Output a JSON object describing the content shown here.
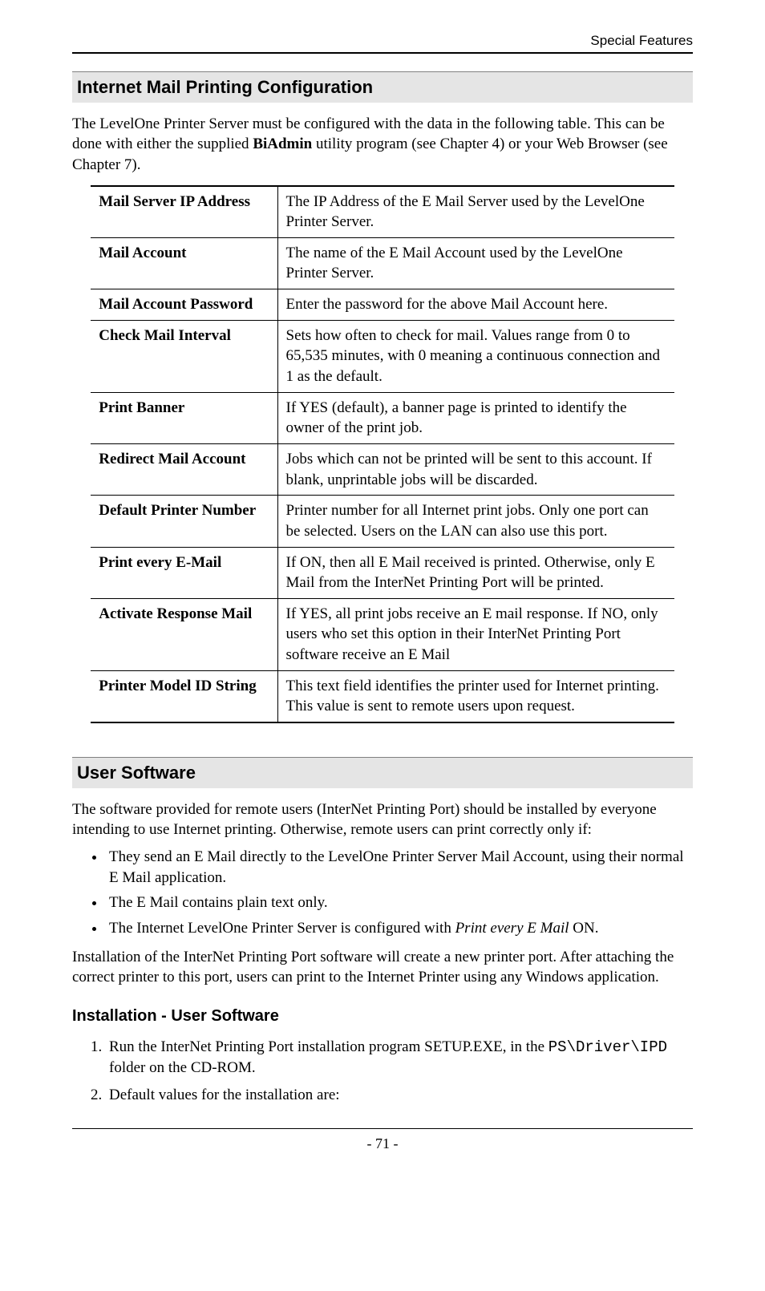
{
  "header": {
    "title": "Special Features"
  },
  "section1": {
    "heading": "Internet Mail Printing Configuration",
    "intro_pre": "The LevelOne Printer Server must be configured with the data in the following table. This can be done with either the supplied ",
    "intro_bold": "BiAdmin",
    "intro_post": " utility program (see Chapter 4) or your Web Browser (see Chapter 7)."
  },
  "table": {
    "rows": [
      {
        "label": "Mail Server IP Address",
        "desc": "The IP Address of the E Mail Server used by the LevelOne Printer Server."
      },
      {
        "label": "Mail Account",
        "desc": "The name of the E Mail Account used by the LevelOne Printer Server."
      },
      {
        "label": "Mail Account Password",
        "desc": "Enter the password for the above Mail Account here."
      },
      {
        "label": "Check Mail Interval",
        "desc": "Sets how often to check for mail. Values range from 0 to 65,535 minutes, with 0 meaning a continuous connection and 1 as the default."
      },
      {
        "label": "Print Banner",
        "desc": "If YES (default), a banner page is printed to identify the owner of the print job."
      },
      {
        "label": "Redirect Mail Account",
        "desc": "Jobs which can not be printed will be sent to this account. If blank, unprintable jobs will be discarded."
      },
      {
        "label": "Default Printer Number",
        "desc": "Printer number for all Internet print jobs. Only one port can be selected. Users on the LAN can also use this port."
      },
      {
        "label": "Print every E-Mail",
        "desc": "If ON, then all E Mail received is printed. Otherwise, only E Mail from the InterNet Printing Port will be printed."
      },
      {
        "label": "Activate Response Mail",
        "desc": "If YES, all print jobs receive an E mail response. If NO, only users who set this option in their InterNet Printing Port software receive an E Mail"
      },
      {
        "label": "Printer Model ID String",
        "desc": "This text field identifies the printer used for Internet printing. This value is sent to remote users upon request."
      }
    ]
  },
  "section2": {
    "heading": "User Software",
    "intro": "The software provided for remote users (InterNet Printing Port) should be installed by everyone intending to use Internet printing. Otherwise, remote users can print correctly only if:",
    "bullets": [
      "They send an E Mail directly to the LevelOne Printer Server Mail Account, using their normal E Mail application.",
      "The E Mail contains plain text only."
    ],
    "bullet3_pre": "The Internet LevelOne Printer Server is configured with ",
    "bullet3_italic": "Print every E Mail",
    "bullet3_post": " ON.",
    "para2": "Installation of the InterNet Printing Port software will create a new printer port. After attaching the correct printer to this port, users can print to the Internet Printer using any Windows application."
  },
  "section3": {
    "heading": "Installation - User Software",
    "step1_pre": "Run the InterNet Printing Port installation program SETUP.EXE, in the ",
    "step1_mono": "PS\\Driver\\IPD",
    "step1_post": " folder on the CD-ROM.",
    "step2": "Default values for the installation are:"
  },
  "footer": {
    "page": "- 71 -"
  }
}
